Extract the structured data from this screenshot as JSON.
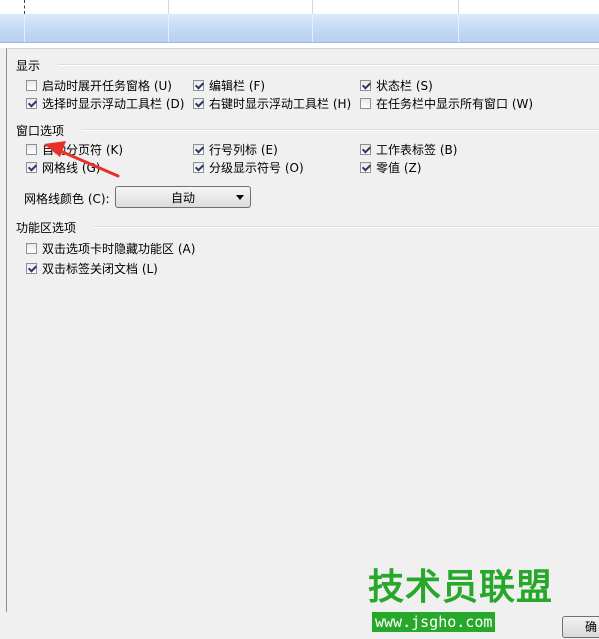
{
  "sections": {
    "display": {
      "title": "显示",
      "items": [
        {
          "label": "启动时展开任务窗格 (U)",
          "checked": false
        },
        {
          "label": "编辑栏 (F)",
          "checked": true
        },
        {
          "label": "状态栏 (S)",
          "checked": true
        },
        {
          "label": "选择时显示浮动工具栏 (D)",
          "checked": true
        },
        {
          "label": "右键时显示浮动工具栏 (H)",
          "checked": true
        },
        {
          "label": "在任务栏中显示所有窗口 (W)",
          "checked": false
        }
      ]
    },
    "window": {
      "title": "窗口选项",
      "items": [
        {
          "label": "自动分页符 (K)",
          "checked": false
        },
        {
          "label": "行号列标 (E)",
          "checked": true
        },
        {
          "label": "工作表标签 (B)",
          "checked": true
        },
        {
          "label": "网格线 (G)",
          "checked": true
        },
        {
          "label": "分级显示符号 (O)",
          "checked": true
        },
        {
          "label": "零值 (Z)",
          "checked": true
        }
      ],
      "grid_color_label": "网格线颜色 (C):",
      "grid_color_value": "自动"
    },
    "ribbon": {
      "title": "功能区选项",
      "items": [
        {
          "label": "双击选项卡时隐藏功能区 (A)",
          "checked": false
        },
        {
          "label": "双击标签关闭文档 (L)",
          "checked": true
        }
      ]
    }
  },
  "ok_button": "确",
  "watermark": {
    "text": "技术员联盟",
    "url": "www.jsgho.com"
  },
  "colors": {
    "accent_arrow": "#e8302a",
    "watermark_green": "#27a82b",
    "band_blue": "#c3d9f5"
  }
}
